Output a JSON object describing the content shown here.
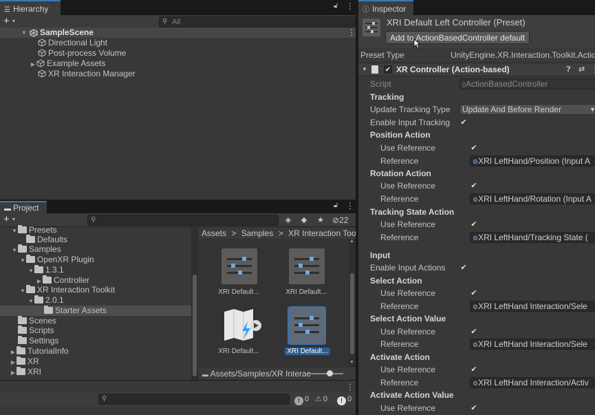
{
  "hierarchy": {
    "tab_label": "Hierarchy",
    "search_placeholder": "All",
    "scene_name": "SampleScene",
    "items": [
      {
        "label": "Directional Light"
      },
      {
        "label": "Post-process Volume"
      },
      {
        "label": "Example Assets"
      },
      {
        "label": "XR Interaction Manager"
      }
    ]
  },
  "project": {
    "tab_label": "Project",
    "badge_count": "22",
    "tree": [
      {
        "label": "Presets"
      },
      {
        "label": "Defaults"
      },
      {
        "label": "Samples"
      },
      {
        "label": "OpenXR Plugin"
      },
      {
        "label": "1.3.1"
      },
      {
        "label": "Controller"
      },
      {
        "label": "XR Interaction Toolkit"
      },
      {
        "label": "2.0.1"
      },
      {
        "label": "Starter Assets"
      },
      {
        "label": "Scenes"
      },
      {
        "label": "Scripts"
      },
      {
        "label": "Settings"
      },
      {
        "label": "TutorialInfo"
      },
      {
        "label": "XR"
      },
      {
        "label": "XRI"
      }
    ],
    "breadcrumb": [
      "Assets",
      "Samples",
      "XR Interaction Toolki"
    ],
    "assets": [
      {
        "label": "XRI Default..."
      },
      {
        "label": "XRI Default..."
      },
      {
        "label": "XRI Default..."
      },
      {
        "label": "XRI Default..."
      }
    ],
    "footer_path": "Assets/Samples/XR Interac"
  },
  "console": {
    "counts": [
      "0",
      "0",
      "0"
    ]
  },
  "inspector": {
    "tab_label": "Inspector",
    "title": "XRI Default Left Controller (Preset)",
    "add_button_label": "Add to ActionBasedController default",
    "preset_type_label": "Preset Type",
    "preset_type_value": "UnityEngine.XR.Interaction.Toolkit.Actio",
    "component_title": "XR Controller (Action-based)",
    "script_label": "Script",
    "script_value": "ActionBasedController",
    "tracking_header": "Tracking",
    "update_tracking_label": "Update Tracking Type",
    "update_tracking_value": "Update And Before Render",
    "enable_input_tracking_label": "Enable Input Tracking",
    "position_action_header": "Position Action",
    "rotation_action_header": "Rotation Action",
    "tracking_state_header": "Tracking State Action",
    "input_header": "Input",
    "enable_input_actions_label": "Enable Input Actions",
    "select_action_header": "Select Action",
    "select_action_value_header": "Select Action Value",
    "activate_action_header": "Activate Action",
    "activate_action_value_header": "Activate Action Value",
    "use_reference_label": "Use Reference",
    "reference_label": "Reference",
    "ref_position": "XRI LeftHand/Position (Input A",
    "ref_rotation": "XRI LeftHand/Rotation (Input A",
    "ref_tracking_state": "XRI LeftHand/Tracking State (",
    "ref_select": "XRI LeftHand Interaction/Sele",
    "ref_select_value": "XRI LeftHand Interaction/Sele",
    "ref_activate": "XRI LeftHand Interaction/Activ"
  }
}
